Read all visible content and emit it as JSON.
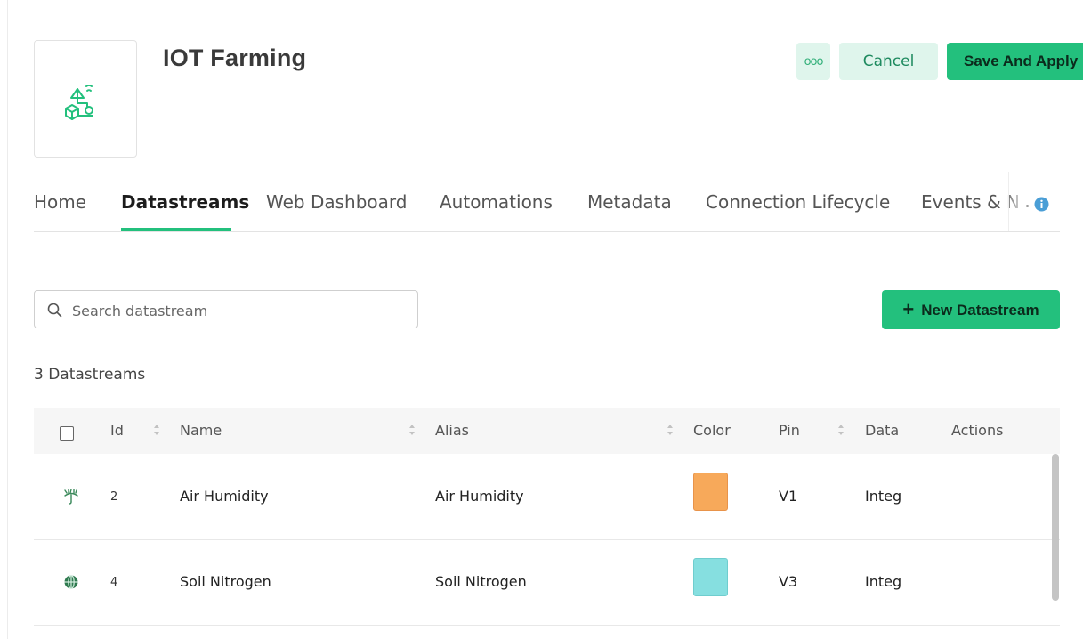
{
  "header": {
    "title": "IOT Farming",
    "more_label": "ooo",
    "cancel_label": "Cancel",
    "save_label": "Save And Apply"
  },
  "tabs": [
    {
      "label": "Home"
    },
    {
      "label": "Datastreams",
      "active": true
    },
    {
      "label": "Web Dashboard"
    },
    {
      "label": "Automations"
    },
    {
      "label": "Metadata"
    },
    {
      "label": "Connection Lifecycle"
    },
    {
      "label": "Events & N"
    }
  ],
  "search": {
    "placeholder": "Search datastream",
    "value": ""
  },
  "new_button": {
    "plus": "+",
    "label": "New Datastream"
  },
  "count_label": "3 Datastreams",
  "table": {
    "columns": {
      "id": "Id",
      "name": "Name",
      "alias": "Alias",
      "color": "Color",
      "pin": "Pin",
      "data": "Data",
      "actions": "Actions"
    },
    "rows": [
      {
        "icon": "air-humidity-icon",
        "id": "2",
        "name": "Air Humidity",
        "alias": "Air Humidity",
        "color": "#f7a95a",
        "pin": "V1",
        "data": "Integ"
      },
      {
        "icon": "globe-icon",
        "id": "4",
        "name": "Soil Nitrogen",
        "alias": "Soil Nitrogen",
        "color": "#86dfe0",
        "pin": "V3",
        "data": "Integ"
      }
    ]
  },
  "colors": {
    "accent": "#23c07d",
    "accent_light": "#dff5ec"
  }
}
